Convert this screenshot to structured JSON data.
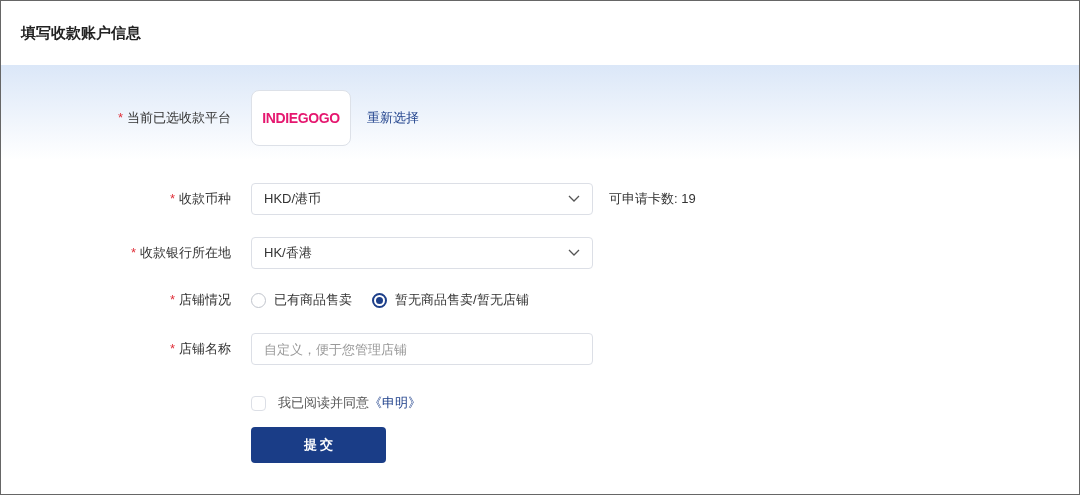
{
  "header": {
    "title": "填写收款账户信息"
  },
  "fields": [
    {
      "kind": "platform",
      "required_mark": "*",
      "label": "当前已选收款平台",
      "logo": "INDIEGOGO",
      "action": "重新选择"
    },
    {
      "kind": "select",
      "required_mark": "*",
      "label": "收款币种",
      "value": "HKD/港币",
      "note": "可申请卡数: 19"
    },
    {
      "kind": "select",
      "required_mark": "*",
      "label": "收款银行所在地",
      "value": "HK/香港"
    },
    {
      "kind": "radio",
      "required_mark": "*",
      "label": "店铺情况",
      "options": [
        {
          "label": "已有商品售卖",
          "selected": false
        },
        {
          "label": "暂无商品售卖/暂无店铺",
          "selected": true
        }
      ]
    },
    {
      "kind": "input",
      "required_mark": "*",
      "label": "店铺名称",
      "placeholder": "自定义，便于您管理店铺"
    }
  ],
  "agreement": {
    "checked": false,
    "text": "我已阅读并同意",
    "link": "《申明》"
  },
  "submit": "提 交"
}
